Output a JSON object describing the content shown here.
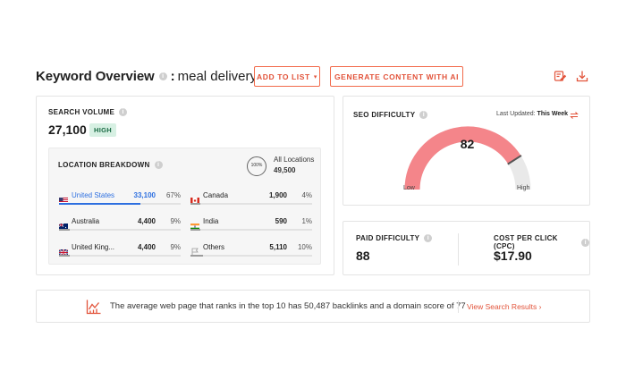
{
  "header": {
    "title": "Keyword Overview",
    "colon": ":",
    "keyword": "meal delivery",
    "add_to_list_label": "ADD TO LIST",
    "generate_label": "GENERATE CONTENT WITH AI",
    "icons": [
      "edit-report-icon",
      "download-icon"
    ]
  },
  "search_volume": {
    "label": "SEARCH VOLUME",
    "value": "27,100",
    "badge": "HIGH"
  },
  "location_breakdown": {
    "label": "LOCATION BREAKDOWN",
    "ring_text": "100%",
    "all_label": "All Locations",
    "all_value": "49,500",
    "countries": [
      {
        "name": "United States",
        "volume": "33,100",
        "pct": "67%",
        "share": 0.67,
        "flag": "us-flag-icon",
        "active": true
      },
      {
        "name": "Canada",
        "volume": "1,900",
        "pct": "4%",
        "share": 0.04,
        "flag": "ca-flag-icon",
        "active": false
      },
      {
        "name": "Australia",
        "volume": "4,400",
        "pct": "9%",
        "share": 0.09,
        "flag": "au-flag-icon",
        "active": false
      },
      {
        "name": "India",
        "volume": "590",
        "pct": "1%",
        "share": 0.01,
        "flag": "in-flag-icon",
        "active": false
      },
      {
        "name": "United King...",
        "volume": "4,400",
        "pct": "9%",
        "share": 0.09,
        "flag": "uk-flag-icon",
        "active": false
      },
      {
        "name": "Others",
        "volume": "5,110",
        "pct": "10%",
        "share": 0.1,
        "flag": "flag-outline-icon",
        "active": false
      }
    ]
  },
  "seo_difficulty": {
    "label": "SEO DIFFICULTY",
    "updated_prefix": "Last Updated:",
    "updated_value": "This Week",
    "value": "82",
    "level": 0.82,
    "low": "Low",
    "high": "High",
    "fill_color": "#f4858a",
    "track_color": "#e9e9e9"
  },
  "paid_difficulty": {
    "label": "PAID DIFFICULTY",
    "value": "88"
  },
  "cpc": {
    "label": "COST PER CLICK (CPC)",
    "value": "$17.90"
  },
  "insight": {
    "text": "The average web page that ranks in the top 10 has 50,487 backlinks and a domain score of 77",
    "link": "View Search Results ›"
  },
  "colors": {
    "accent": "#e2533a",
    "link_blue": "#2d6fe0",
    "badge_bg": "#d7f0e3"
  }
}
